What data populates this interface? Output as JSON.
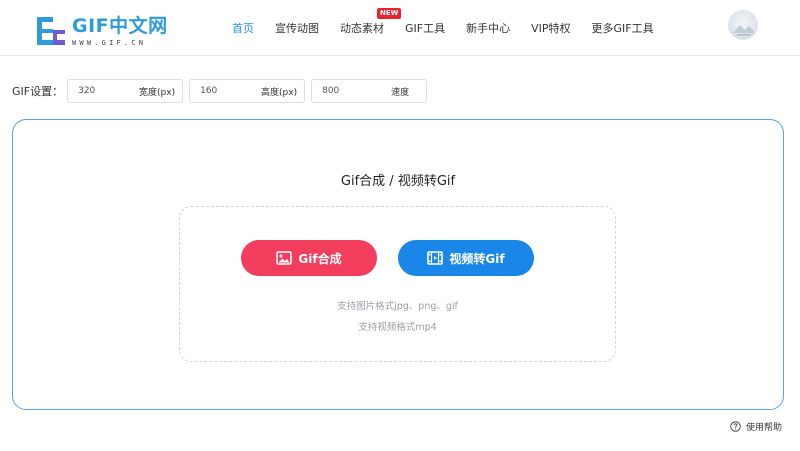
{
  "logo": {
    "title": "GIF中文网",
    "subtitle": "WWW.GIF.CN"
  },
  "nav": {
    "items": [
      {
        "label": "首页",
        "active": true
      },
      {
        "label": "宣传动图"
      },
      {
        "label": "动态素材",
        "badge": "NEW"
      },
      {
        "label": "GIF工具"
      },
      {
        "label": "新手中心"
      },
      {
        "label": "VIP特权"
      },
      {
        "label": "更多GIF工具"
      }
    ]
  },
  "settings": {
    "label": "GIF设置：",
    "width": {
      "value": "320",
      "unit": "宽度(px)"
    },
    "height": {
      "value": "160",
      "unit": "高度(px)"
    },
    "speed": {
      "value": "800",
      "unit": "速度"
    }
  },
  "panel": {
    "title": "Gif合成 / 视频转Gif",
    "gif_button": "Gif合成",
    "video_button": "视频转Gif",
    "hint_image": "支持图片格式jpg、png、gif",
    "hint_video": "支持视频格式mp4"
  },
  "help": {
    "label": "使用帮助"
  },
  "colors": {
    "accent": "#2d8ff0",
    "gif_button": "#f33d5d",
    "video_button": "#1a86e8",
    "panel_border": "#5aa3e6",
    "badge": "#e8232f"
  }
}
